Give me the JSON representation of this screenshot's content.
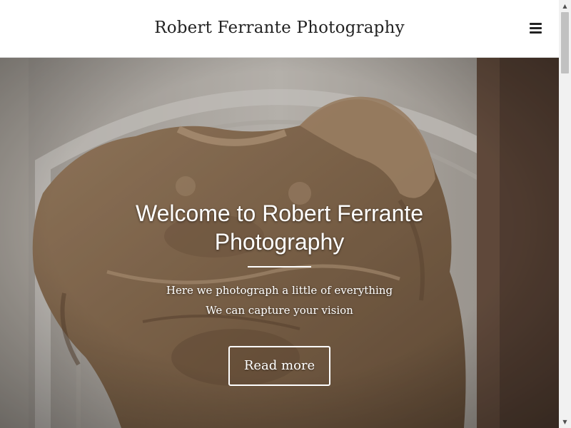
{
  "header": {
    "site_title": "Robert Ferrante Photography",
    "menu_icon": "hamburger-menu-icon"
  },
  "hero": {
    "heading": "Welcome to Robert Ferrante Photography",
    "line1": "Here we photograph a little of everything",
    "line2": "We can capture your vision",
    "button_label": "Read more",
    "background_image": "carved stone torso sculpture in museum gallery"
  },
  "scrollbar": {
    "up_icon": "scroll-up-arrow-icon",
    "down_icon": "scroll-down-arrow-icon",
    "up_glyph": "▲",
    "down_glyph": "▼"
  },
  "colors": {
    "header_background": "#ffffff",
    "title_text": "#222222",
    "hero_text": "#ffffff",
    "stone": "#9a7c5c"
  }
}
